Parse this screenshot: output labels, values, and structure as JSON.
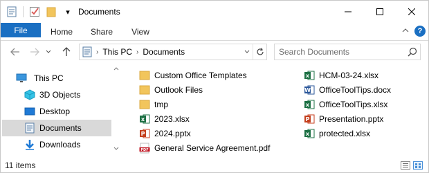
{
  "window": {
    "title": "Documents",
    "qat_dropdown": "▾"
  },
  "ribbon": {
    "tabs": [
      {
        "label": "File",
        "active": true
      },
      {
        "label": "Home"
      },
      {
        "label": "Share"
      },
      {
        "label": "View"
      }
    ],
    "help_label": "?"
  },
  "address": {
    "segments": [
      "This PC",
      "Documents"
    ],
    "search_placeholder": "Search Documents"
  },
  "nav_pane": {
    "items": [
      {
        "label": "This PC",
        "icon": "computer-icon"
      },
      {
        "label": "3D Objects",
        "icon": "cube-3d-icon"
      },
      {
        "label": "Desktop",
        "icon": "desktop-icon"
      },
      {
        "label": "Documents",
        "icon": "documents-icon",
        "selected": true
      },
      {
        "label": "Downloads",
        "icon": "downloads-icon"
      }
    ]
  },
  "files": [
    {
      "name": "Custom Office Templates",
      "type": "folder"
    },
    {
      "name": "Outlook Files",
      "type": "folder"
    },
    {
      "name": "tmp",
      "type": "folder"
    },
    {
      "name": "2023.xlsx",
      "type": "excel"
    },
    {
      "name": "2024.pptx",
      "type": "powerpoint"
    },
    {
      "name": "General Service Agreement.pdf",
      "type": "pdf"
    },
    {
      "name": "HCM-03-24.xlsx",
      "type": "excel"
    },
    {
      "name": "OfficeToolTips.docx",
      "type": "word"
    },
    {
      "name": "OfficeToolTips.xlsx",
      "type": "excel"
    },
    {
      "name": "Presentation.pptx",
      "type": "powerpoint"
    },
    {
      "name": "protected.xlsx",
      "type": "excel"
    }
  ],
  "status": {
    "item_count": "11 items"
  },
  "colors": {
    "accent": "#1a6fc2",
    "folder": "#f2c55c",
    "excel": "#1d7044",
    "word": "#2b579a",
    "powerpoint": "#c43e1c",
    "pdf": "#c1121f",
    "selected_bg": "#d9d9d9"
  }
}
